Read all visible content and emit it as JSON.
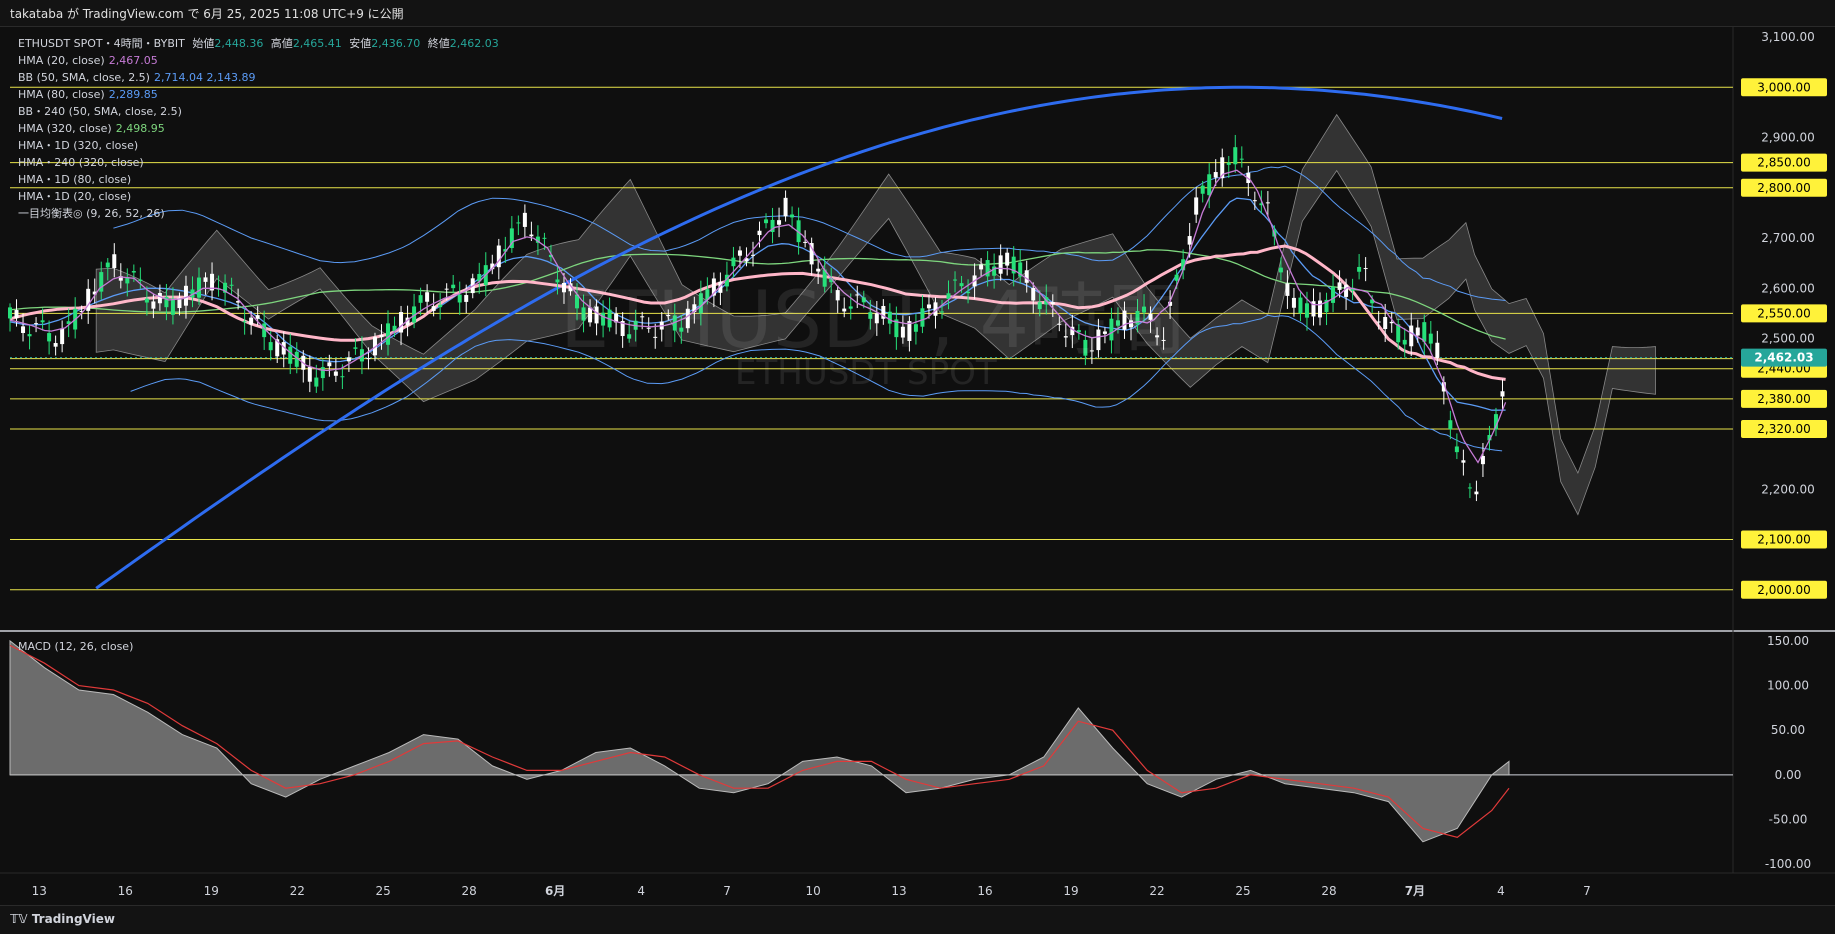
{
  "header": {
    "text": "takataba が TradingView.com で 6月 25, 2025 11:08 UTC+9 に公開"
  },
  "legend": {
    "symbol": "ETHUSDT SPOT・4時間・BYBIT",
    "ohlc": [
      {
        "label": "始値",
        "value": "2,448.36"
      },
      {
        "label": "高値",
        "value": "2,465.41"
      },
      {
        "label": "安値",
        "value": "2,436.70"
      },
      {
        "label": "終値",
        "value": "2,462.03"
      }
    ],
    "indicators": [
      {
        "name": "HMA (20, close)",
        "value": "2,467.05",
        "color": "#c67bd6"
      },
      {
        "name": "BB (50, SMA, close, 2.5)",
        "value": "2,714.04  2,143.89",
        "color": "#5b9bf5"
      },
      {
        "name": "HMA (80, close)",
        "value": "2,289.85",
        "color": "#5b9bf5"
      },
      {
        "name": "BB・240 (50, SMA, close, 2.5)",
        "value": "",
        "color": "#d1d4dc"
      },
      {
        "name": "HMA (320, close)",
        "value": "2,498.95",
        "color": "#7ed67e"
      },
      {
        "name": "HMA・1D (320, close)",
        "value": "",
        "color": "#d1d4dc"
      },
      {
        "name": "HMA・240 (320, close)",
        "value": "",
        "color": "#d1d4dc"
      },
      {
        "name": "HMA・1D (80, close)",
        "value": "",
        "color": "#d1d4dc"
      },
      {
        "name": "HMA・1D (20, close)",
        "value": "",
        "color": "#d1d4dc"
      },
      {
        "name": "一目均衡表◎ (9, 26, 52, 26)",
        "value": "",
        "color": "#d1d4dc"
      }
    ]
  },
  "watermark": {
    "title": "ETHUSDT, 4時間",
    "subtitle": "ETHUSDT SPOT"
  },
  "macd": {
    "label": "MACD (12, 26, close)"
  },
  "footer": {
    "brand": "TradingView"
  },
  "colors": {
    "up": "#26e07a",
    "down": "#ffffff",
    "hma20": "#c67bd6",
    "hma80_1d": "#ffb6c8",
    "hma320": "#2e6cf0",
    "bb": "#5b9bf5",
    "hma240": "#7ed67e",
    "level_line": "#e8e34a",
    "level_label_bg": "#fff23a",
    "price_label_bg": "#26a69a"
  },
  "chart_data": [
    {
      "type": "candlestick",
      "title": "ETHUSDT SPOT・4時間・BYBIT",
      "x_tick_labels": [
        "13",
        "16",
        "19",
        "22",
        "25",
        "28",
        "6月",
        "4",
        "7",
        "10",
        "13",
        "16",
        "19",
        "22",
        "25",
        "28",
        "7月",
        "4",
        "7"
      ],
      "y_tick_labels": [
        "3,100.00",
        "2,900.00",
        "2,700.00",
        "2,600.00",
        "2,500.00",
        "2,200.00"
      ],
      "ylim": [
        1920,
        3120
      ],
      "horizontal_levels": [
        "3,000.00",
        "2,850.00",
        "2,800.00",
        "2,550.00",
        "2,460.00",
        "2,440.00",
        "2,380.00",
        "2,320.00",
        "2,100.00",
        "2,000.00"
      ],
      "current_price": "2,462.03",
      "close_path_x": [
        0,
        0.03,
        0.06,
        0.09,
        0.12,
        0.15,
        0.18,
        0.21,
        0.24,
        0.27,
        0.3,
        0.33,
        0.36,
        0.39,
        0.42,
        0.45,
        0.48,
        0.5,
        0.52,
        0.55,
        0.58,
        0.6,
        0.625,
        0.64,
        0.655,
        0.67,
        0.69,
        0.71,
        0.73,
        0.745,
        0.76,
        0.775,
        0.785,
        0.79,
        0.8,
        0.81,
        0.82,
        0.83,
        0.84,
        0.85,
        0.86,
        0.87
      ],
      "close_path": [
        2540,
        2500,
        2650,
        2560,
        2620,
        2500,
        2420,
        2480,
        2570,
        2600,
        2740,
        2560,
        2520,
        2530,
        2640,
        2760,
        2580,
        2560,
        2510,
        2600,
        2660,
        2570,
        2480,
        2520,
        2550,
        2510,
        2780,
        2870,
        2750,
        2560,
        2560,
        2600,
        2640,
        2580,
        2520,
        2500,
        2520,
        2460,
        2260,
        2200,
        2300,
        2462
      ]
    },
    {
      "type": "area",
      "title": "MACD (12, 26, close)",
      "y_tick_labels": [
        "150.00",
        "100.00",
        "50.00",
        "0.00",
        "-50.00",
        "-100.00"
      ],
      "ylim": [
        -110,
        160
      ],
      "macd_x": [
        0,
        0.02,
        0.04,
        0.06,
        0.08,
        0.1,
        0.12,
        0.14,
        0.16,
        0.18,
        0.2,
        0.22,
        0.24,
        0.26,
        0.28,
        0.3,
        0.32,
        0.34,
        0.36,
        0.38,
        0.4,
        0.42,
        0.44,
        0.46,
        0.48,
        0.5,
        0.52,
        0.54,
        0.56,
        0.58,
        0.6,
        0.62,
        0.64,
        0.66,
        0.68,
        0.7,
        0.72,
        0.74,
        0.76,
        0.78,
        0.8,
        0.82,
        0.84,
        0.86,
        0.87
      ],
      "macd": [
        150,
        120,
        95,
        90,
        70,
        45,
        30,
        -10,
        -25,
        -5,
        10,
        25,
        45,
        40,
        10,
        -5,
        5,
        25,
        30,
        10,
        -15,
        -20,
        -10,
        15,
        20,
        10,
        -20,
        -15,
        -5,
        0,
        20,
        75,
        30,
        -10,
        -25,
        -5,
        5,
        -10,
        -15,
        -20,
        -30,
        -75,
        -60,
        0,
        15
      ],
      "signal": [
        145,
        125,
        100,
        95,
        80,
        55,
        35,
        5,
        -15,
        -10,
        0,
        15,
        35,
        38,
        20,
        5,
        5,
        15,
        25,
        20,
        0,
        -15,
        -15,
        5,
        15,
        15,
        -5,
        -15,
        -10,
        -5,
        10,
        60,
        50,
        5,
        -20,
        -15,
        0,
        -5,
        -10,
        -15,
        -25,
        -60,
        -70,
        -40,
        -15
      ]
    }
  ]
}
